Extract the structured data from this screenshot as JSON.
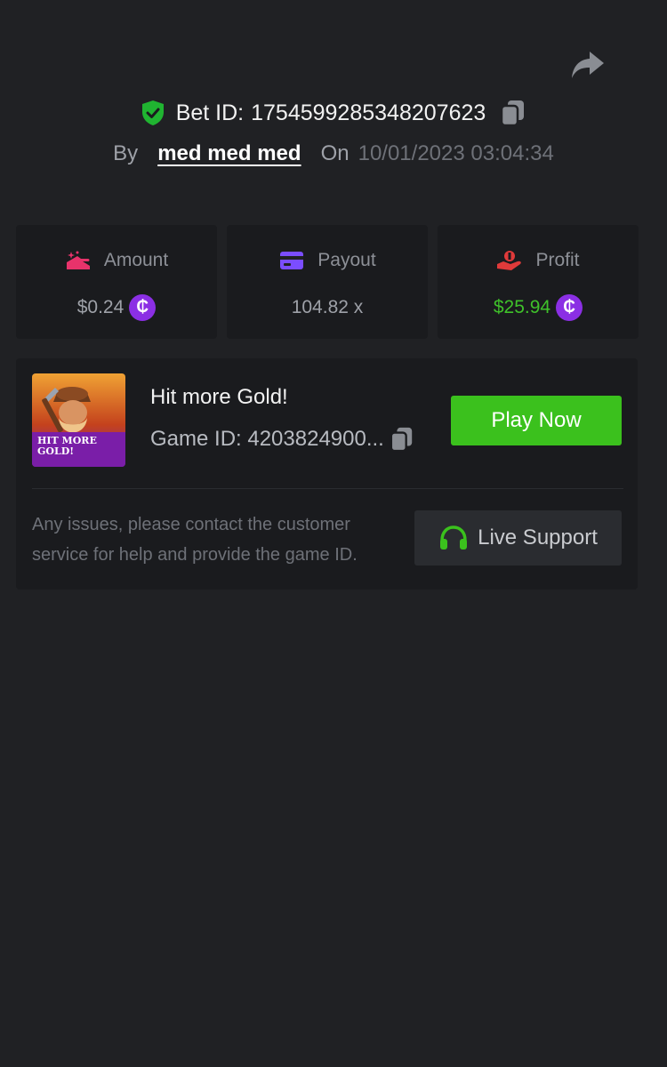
{
  "bet": {
    "id_label": "Bet ID:",
    "id_value": "1754599285348207623",
    "by_label": "By",
    "username": "med med med",
    "on_label": "On",
    "datetime": "10/01/2023 03:04:34"
  },
  "stats": {
    "amount": {
      "label": "Amount",
      "value": "$0.24",
      "icon": "coins-hand-icon"
    },
    "payout": {
      "label": "Payout",
      "value": "104.82 x",
      "icon": "credit-card-icon"
    },
    "profit": {
      "label": "Profit",
      "value": "$25.94",
      "icon": "hand-money-icon"
    }
  },
  "coin_symbol": "₵",
  "game": {
    "title": "Hit more Gold!",
    "id_text": "Game ID: 4203824900...",
    "thumb_text_line1": "HIT MORE",
    "thumb_text_line2": "GOLD!",
    "play_label": "Play Now"
  },
  "support": {
    "help_text": "Any issues, please contact the customer service for help and provide the game ID.",
    "button_label": "Live Support"
  },
  "colors": {
    "background": "#202124",
    "card": "#1a1b1e",
    "accent_green": "#3bc11d",
    "profit_green": "#3fc12a",
    "coin_purple": "#8b2fe4",
    "amount_pink": "#e8336b",
    "payout_purple": "#7b4dff",
    "profit_red": "#e03a3a"
  }
}
